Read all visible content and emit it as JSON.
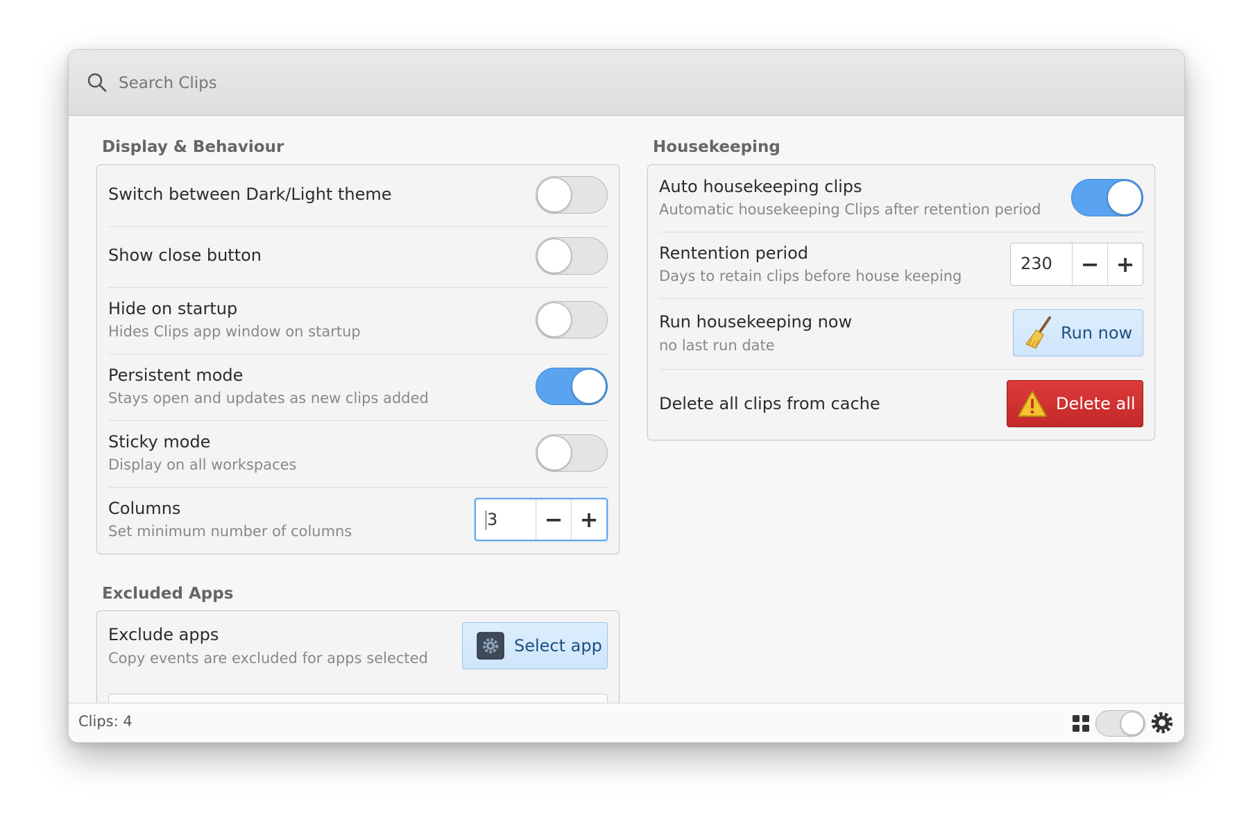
{
  "search": {
    "placeholder": "Search Clips"
  },
  "display": {
    "title": "Display & Behaviour",
    "rows": [
      {
        "title": "Switch between Dark/Light theme",
        "enabled": false
      },
      {
        "title": "Show close button",
        "enabled": false
      },
      {
        "title": "Hide on startup",
        "subtitle": "Hides Clips app window on startup",
        "enabled": false
      },
      {
        "title": "Persistent mode",
        "subtitle": "Stays open and updates as new clips added",
        "enabled": true
      },
      {
        "title": "Sticky mode",
        "subtitle": "Display on all workspaces",
        "enabled": false
      },
      {
        "title": "Columns",
        "subtitle": "Set minimum number of columns",
        "value": "3"
      }
    ]
  },
  "excluded": {
    "title": "Excluded Apps",
    "row": {
      "title": "Exclude apps",
      "subtitle": "Copy events are excluded for apps selected",
      "button": "Select app"
    }
  },
  "housekeeping": {
    "title": "Housekeeping",
    "auto": {
      "title": "Auto housekeeping clips",
      "subtitle": "Automatic housekeeping Clips after retention period",
      "enabled": true
    },
    "retention": {
      "title": "Rentention period",
      "subtitle": "Days to retain clips before house keeping",
      "value": "230"
    },
    "run": {
      "title": "Run housekeeping now",
      "subtitle": "no last run date",
      "button": "Run now"
    },
    "delete": {
      "title": "Delete all clips from cache",
      "button": "Delete all"
    }
  },
  "spin": {
    "minus": "−",
    "plus": "+"
  },
  "footer": {
    "clips_label": "Clips: 4",
    "view_toggle_enabled": false
  },
  "colors": {
    "accent": "#5aa3f0",
    "danger": "#d03232",
    "button_blue": "#d5e9fb"
  },
  "icons": [
    "search-icon",
    "broom-icon",
    "warning-icon",
    "gear-app-icon",
    "grid-icon",
    "settings-gear-icon"
  ]
}
